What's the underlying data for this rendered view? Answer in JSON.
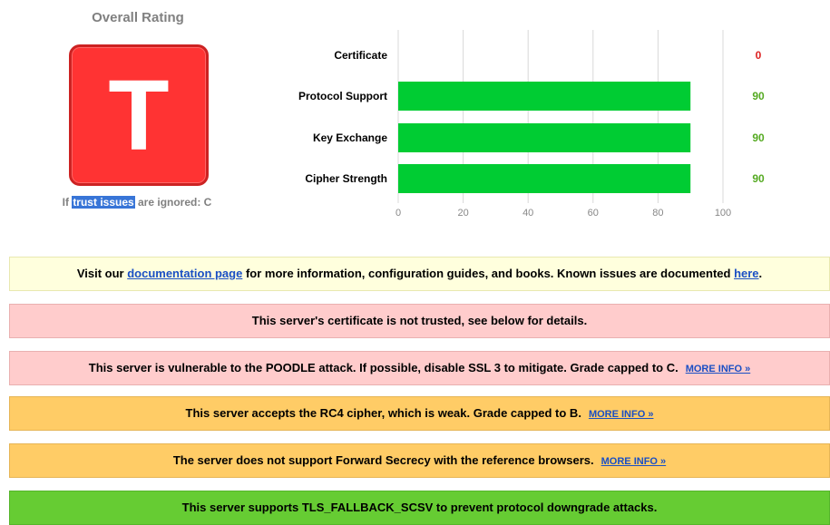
{
  "overall": {
    "title": "Overall Rating",
    "grade": "T",
    "ignored_prefix": "If ",
    "ignored_highlight": "trust issues",
    "ignored_suffix": " are ignored: C"
  },
  "chart_data": {
    "type": "bar",
    "orientation": "horizontal",
    "categories": [
      "Certificate",
      "Protocol Support",
      "Key Exchange",
      "Cipher Strength"
    ],
    "values": [
      0,
      90,
      90,
      90
    ],
    "value_labels": [
      "0",
      "90",
      "90",
      "90"
    ],
    "value_label_colors": [
      "#dd2222",
      "#55aa22",
      "#55aa22",
      "#55aa22"
    ],
    "xlim": [
      0,
      100
    ],
    "xticks": [
      0,
      20,
      40,
      60,
      80,
      100
    ],
    "bar_color": "#00cc33",
    "grid": true
  },
  "notices": [
    {
      "style": "yellow",
      "parts": [
        {
          "text": "Visit our "
        },
        {
          "text": "documentation page",
          "link": true
        },
        {
          "text": " for more information, configuration guides, and books. Known issues are documented "
        },
        {
          "text": "here",
          "link": true
        },
        {
          "text": "."
        }
      ]
    },
    {
      "style": "red",
      "parts": [
        {
          "text": "This server's certificate is not trusted, see below for details."
        }
      ]
    },
    {
      "style": "red",
      "parts": [
        {
          "text": "This server is vulnerable to the POODLE attack. If possible, disable SSL 3 to mitigate. Grade capped to C."
        },
        {
          "text": "MORE INFO »",
          "more": true
        }
      ]
    },
    {
      "style": "orange",
      "parts": [
        {
          "text": "This server accepts the RC4 cipher, which is weak. Grade capped to B."
        },
        {
          "text": "MORE INFO »",
          "more": true
        }
      ]
    },
    {
      "style": "orange",
      "parts": [
        {
          "text": "The server does not support Forward Secrecy with the reference browsers."
        },
        {
          "text": "MORE INFO »",
          "more": true
        }
      ]
    },
    {
      "style": "green",
      "parts": [
        {
          "text": "This server supports TLS_FALLBACK_SCSV to prevent protocol downgrade attacks."
        }
      ]
    }
  ]
}
